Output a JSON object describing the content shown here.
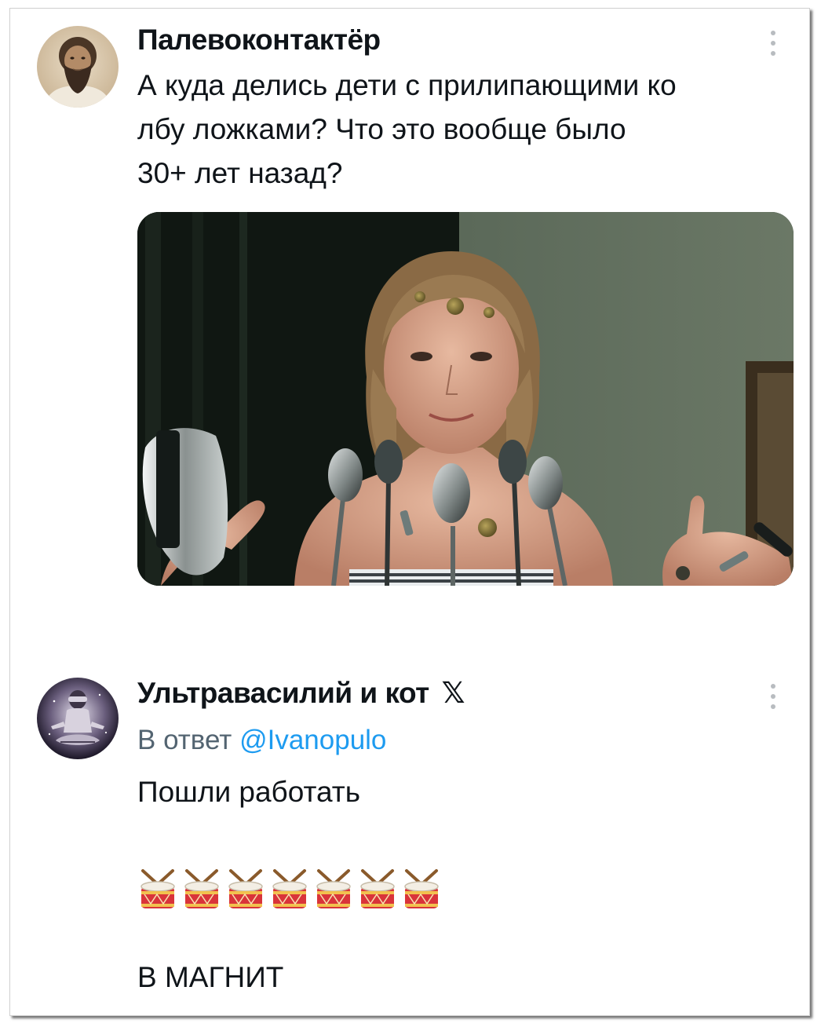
{
  "tweet1": {
    "author": "Палевоконтактёр",
    "text_line1": "А куда делись дети с прилипающими ко",
    "text_line2": "лбу ложками? Что это вообще было",
    "text_line3": "30+ лет назад?",
    "avatar_icon": "bearded-man-portrait",
    "menu_icon": "more-vertical-icon"
  },
  "tweet2": {
    "author": "Ультравасилий и кот",
    "badge": "𝕏",
    "reply_prefix": "В ответ",
    "reply_handle": "@Ivanopulo",
    "line1": "Пошли работать",
    "emoji_icon": "drum-emoji",
    "emoji_count": 7,
    "line2": "В МАГНИТ",
    "avatar_icon": "meditating-figure-art",
    "menu_icon": "more-vertical-icon"
  },
  "colors": {
    "text": "#0f1419",
    "secondary": "#536471",
    "link": "#1d9bf0",
    "menu_dots": "#b8bcc0"
  }
}
